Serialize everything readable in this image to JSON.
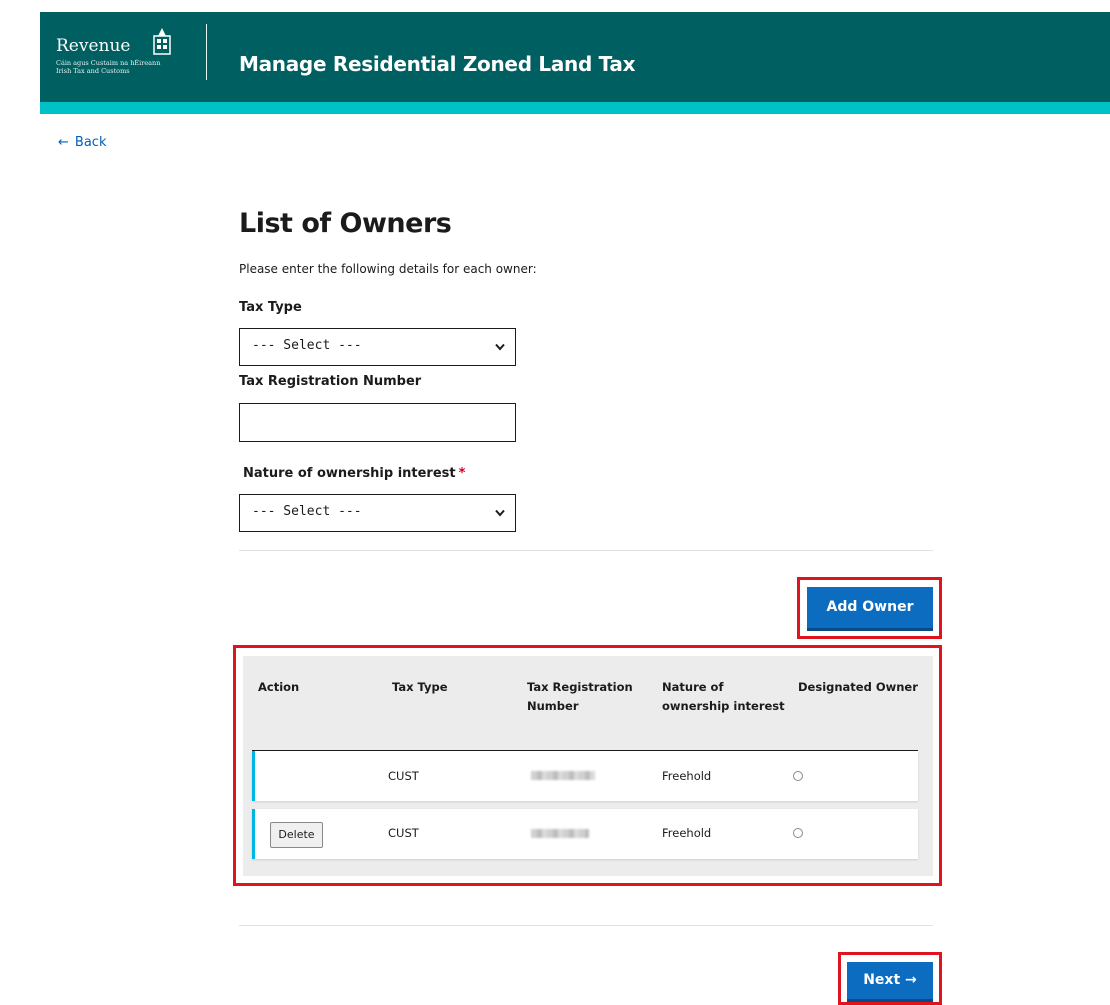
{
  "header": {
    "logo_word": "Revenue",
    "logo_line1": "Cáin agus Custaim na hÉireann",
    "logo_line2": "Irish Tax and Customs",
    "title": "Manage Residential Zoned Land Tax"
  },
  "nav": {
    "back_label": "Back"
  },
  "page": {
    "title": "List of Owners",
    "intro": "Please enter the following details for each owner:"
  },
  "form": {
    "tax_type_label": "Tax Type",
    "tax_type_value": "--- Select ---",
    "trn_label": "Tax Registration Number",
    "trn_value": "",
    "nature_label": "Nature of ownership interest",
    "nature_required": "*",
    "nature_value": "--- Select ---"
  },
  "buttons": {
    "add_owner": "Add Owner",
    "next": "Next →"
  },
  "table": {
    "headers": {
      "action": "Action",
      "tax_type": "Tax Type",
      "trn_line1": "Tax Registration",
      "trn_line2": "Number",
      "nature_line1": "Nature of",
      "nature_line2": "ownership interest",
      "designated": "Designated Owner"
    },
    "rows": [
      {
        "action": "",
        "tax_type": "CUST",
        "nature": "Freehold"
      },
      {
        "action": "Delete",
        "tax_type": "CUST",
        "nature": "Freehold"
      }
    ]
  },
  "colors": {
    "header_bg": "#005f61",
    "header_accent": "#00c1c6",
    "primary_button": "#0c6cbf",
    "link": "#0060b5",
    "highlight_box": "#e0141e",
    "row_accent": "#00b5e2"
  },
  "icons": [
    "back-arrow-icon",
    "chevron-down-icon",
    "crest-icon",
    "next-arrow-icon"
  ]
}
